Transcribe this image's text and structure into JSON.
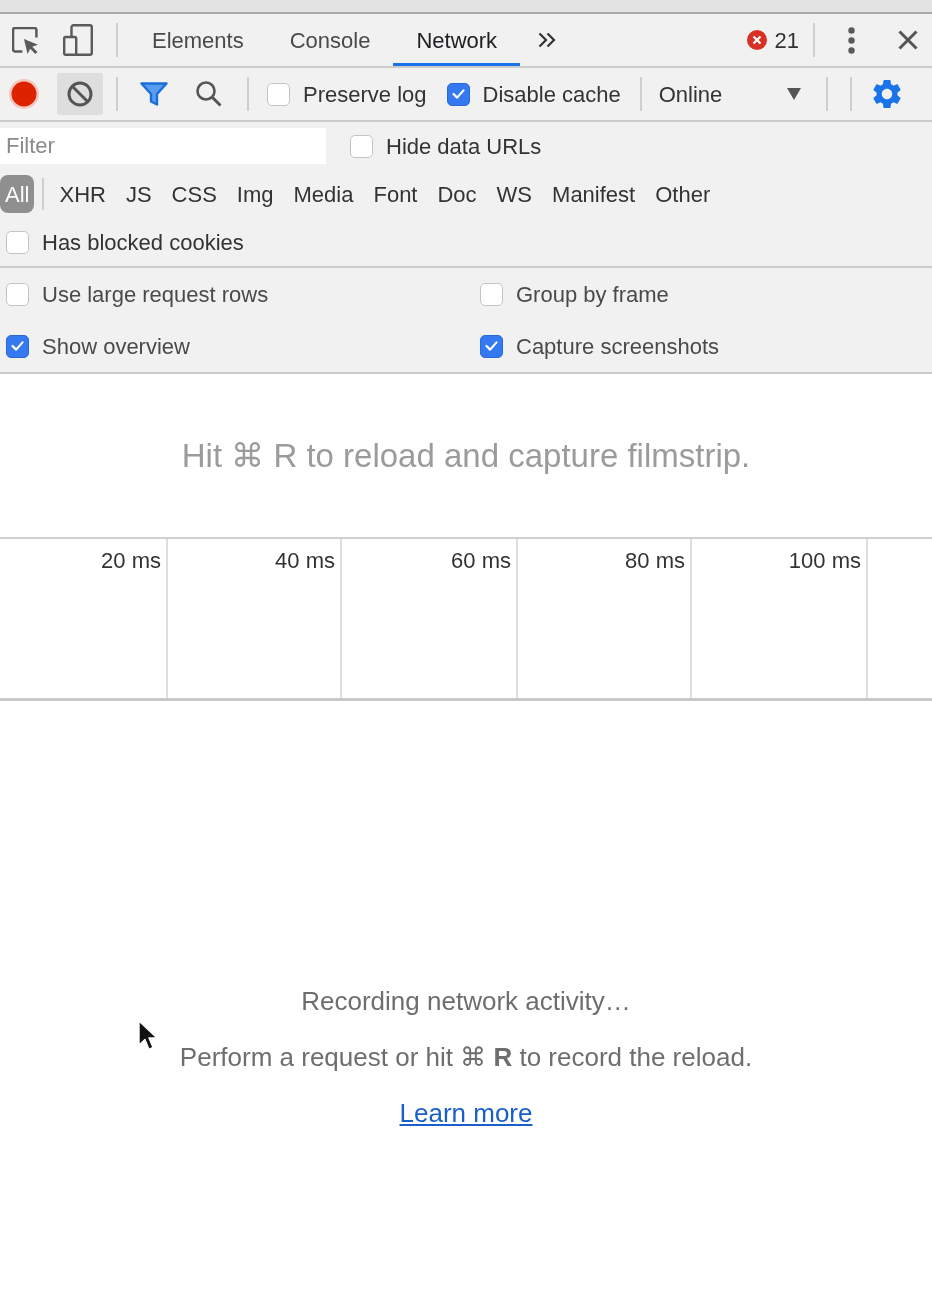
{
  "top_bar": {
    "tabs": [
      {
        "label": "Elements",
        "selected": false
      },
      {
        "label": "Console",
        "selected": false
      },
      {
        "label": "Network",
        "selected": true
      }
    ],
    "error_count": "21"
  },
  "toolbar": {
    "recording": true,
    "options": [
      {
        "label": "Preserve log",
        "checked": false
      },
      {
        "label": "Disable cache",
        "checked": true
      }
    ],
    "throttling": "Online"
  },
  "filter_bar": {
    "filter": {
      "placeholder": "Filter"
    },
    "hide_data_urls": {
      "label": "Hide data URLs",
      "checked": false
    },
    "types": [
      {
        "label": "All",
        "selected": true
      },
      {
        "label": "XHR",
        "selected": false
      },
      {
        "label": "JS",
        "selected": false
      },
      {
        "label": "CSS",
        "selected": false
      },
      {
        "label": "Img",
        "selected": false
      },
      {
        "label": "Media",
        "selected": false
      },
      {
        "label": "Font",
        "selected": false
      },
      {
        "label": "Doc",
        "selected": false
      },
      {
        "label": "WS",
        "selected": false
      },
      {
        "label": "Manifest",
        "selected": false
      },
      {
        "label": "Other",
        "selected": false
      }
    ],
    "blocked_cookies": {
      "label": "Has blocked cookies",
      "checked": false
    }
  },
  "settings": [
    {
      "label": "Use large request rows",
      "checked": false
    },
    {
      "label": "Group by frame",
      "checked": false
    },
    {
      "label": "Show overview",
      "checked": true
    },
    {
      "label": "Capture screenshots",
      "checked": true
    }
  ],
  "filmstrip": {
    "hint": "Hit ⌘ R to reload and capture filmstrip."
  },
  "overview": {
    "ticks": [
      "20 ms",
      "40 ms",
      "60 ms",
      "80 ms",
      "100 ms"
    ]
  },
  "empty_state": {
    "title": "Recording network activity…",
    "message": "Perform a request or hit ⌘ **R** to record the reload.",
    "link": "Learn more"
  }
}
